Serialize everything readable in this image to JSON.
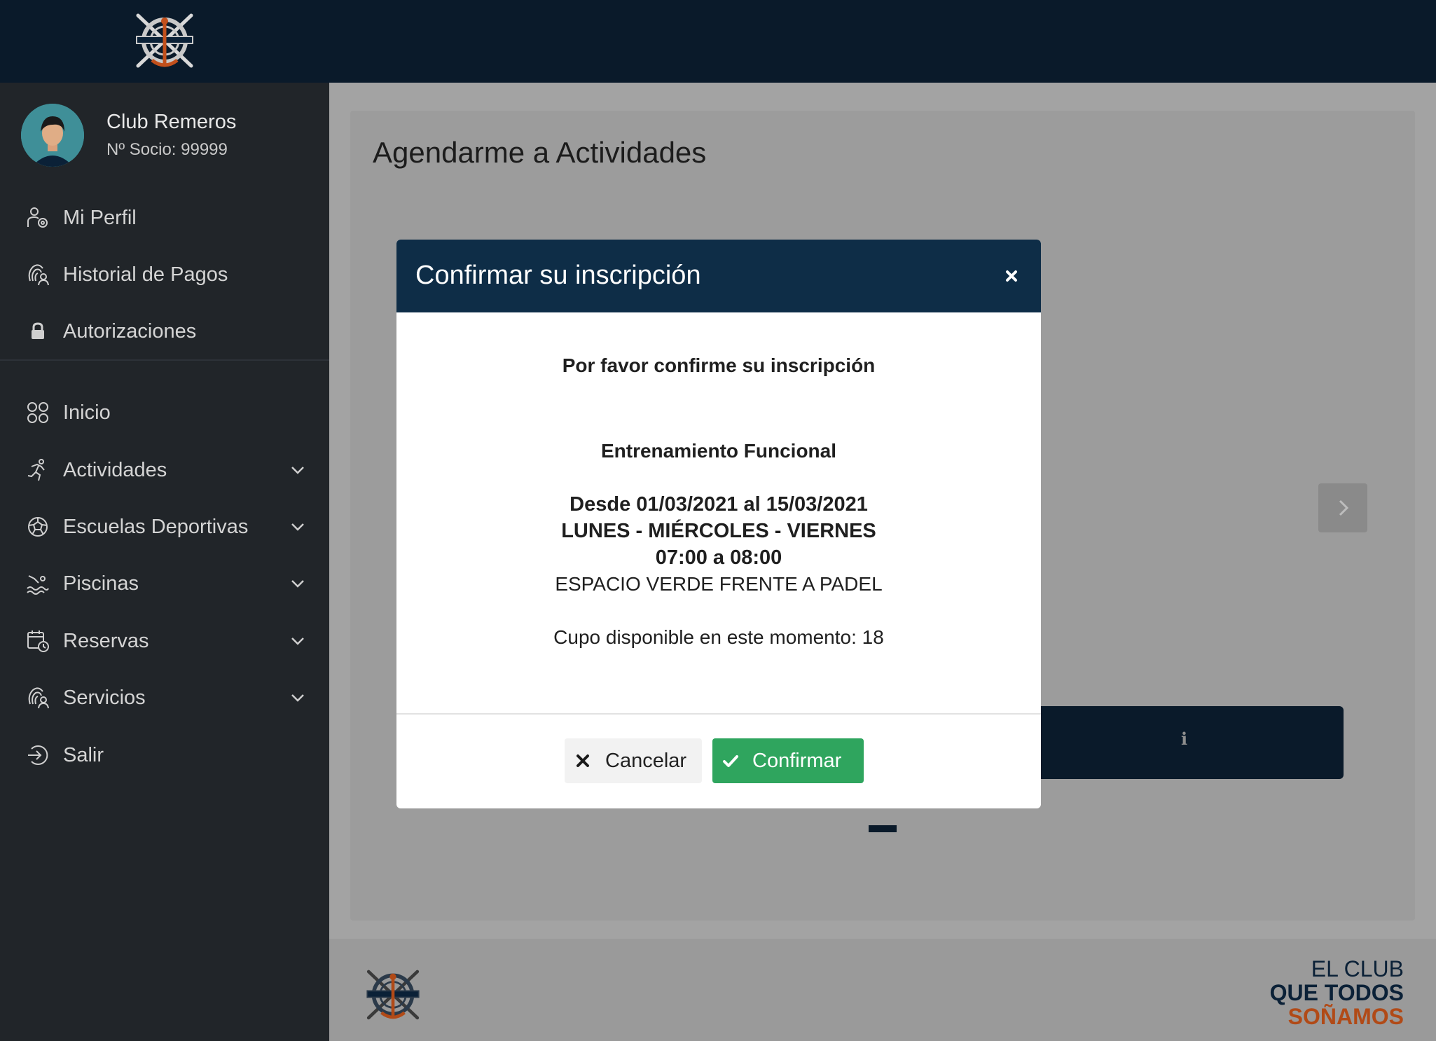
{
  "colors": {
    "topbar": "#0a1a2a",
    "sidebar": "#212529",
    "modal_header": "#0e2d47",
    "confirm_green": "#2fa55e",
    "brand_orange": "#b14a17"
  },
  "header": {
    "logo_icon": "rowing-club-logo-icon"
  },
  "user": {
    "name": "Club Remeros",
    "socio": "Nº Socio: 99999",
    "avatar_icon": "user-avatar-icon"
  },
  "sidebar": {
    "items": [
      {
        "label": "Mi Perfil",
        "icon": "profile-gear-icon"
      },
      {
        "label": "Historial de Pagos",
        "icon": "fingerprint-user-icon"
      },
      {
        "label": "Autorizaciones",
        "icon": "lock-icon"
      },
      {
        "label": "Inicio",
        "icon": "grid-circles-icon"
      },
      {
        "label": "Actividades",
        "icon": "running-person-icon"
      },
      {
        "label": "Escuelas Deportivas",
        "icon": "sports-ball-icon"
      },
      {
        "label": "Piscinas",
        "icon": "swimmer-icon"
      },
      {
        "label": "Reservas",
        "icon": "calendar-clock-icon"
      },
      {
        "label": "Servicios",
        "icon": "fingerprint-user-icon"
      },
      {
        "label": "Salir",
        "icon": "logout-icon"
      }
    ]
  },
  "main": {
    "title": "Agendarme a Actividades"
  },
  "modal": {
    "title": "Confirmar su inscripción",
    "prompt": "Por favor confirme su inscripción",
    "activity": "Entrenamiento Funcional",
    "dates": "Desde 01/03/2021 al 15/03/2021",
    "days": "LUNES - MIÉRCOLES - VIERNES",
    "time": "07:00 a 08:00",
    "location": "ESPACIO VERDE FRENTE A PADEL",
    "capacity": "Cupo disponible en este momento: 18",
    "cancel_label": "Cancelar",
    "confirm_label": "Confirmar"
  },
  "footer": {
    "slogan_1": "EL CLUB",
    "slogan_2": "QUE TODOS",
    "slogan_3": "SOÑAMOS"
  }
}
